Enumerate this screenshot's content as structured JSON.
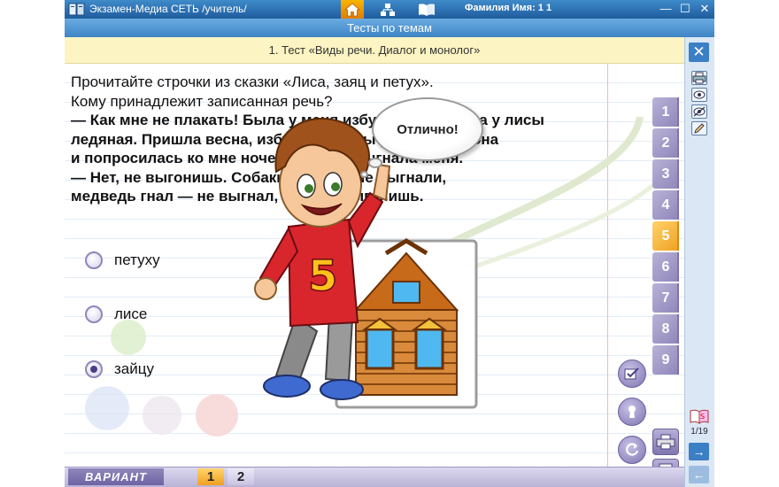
{
  "titlebar": {
    "title": "Экзамен-Медиа СЕТЬ /учитель/",
    "user": "Фамилия Имя:  1 1",
    "nav_icons": [
      "home-icon",
      "hierarchy-icon",
      "book-icon"
    ],
    "window_controls": {
      "minimize": "—",
      "maximize": "☐",
      "close": "✕"
    }
  },
  "section": {
    "title": "Тесты по темам"
  },
  "test": {
    "title": "1. Тест «Виды речи. Диалог и монолог»"
  },
  "question": {
    "intro_1": "Прочитайте строчки из сказки «Лиса, заяц и петух».",
    "intro_2": "Кому принадлежит записанная речь?",
    "text_1": "— Как мне не плакать! Была у меня избушка лубяная, а у лисы",
    "text_2": "ледяная. Пришла весна, избушка у лисы растаяла — она",
    "text_3": "и попросилась ко мне ночевать, да и выгнала меня.",
    "text_4": "— Нет, не выгонишь. Собаки гнали — не выгнали,",
    "text_5": "медведь гнал — не выгнал, и ты не выгонишь."
  },
  "options": [
    {
      "label": "петуху",
      "selected": false
    },
    {
      "label": "лисе",
      "selected": false
    },
    {
      "label": "зайцу",
      "selected": true
    }
  ],
  "question_tabs": [
    "1",
    "2",
    "3",
    "4",
    "5",
    "6",
    "7",
    "8",
    "9"
  ],
  "current_question_tab": "5",
  "feedback": {
    "text": "Отлично!"
  },
  "mascot": {
    "shirt_number": "5"
  },
  "side_tools": [
    "print-icon",
    "eye-icon",
    "eye-crossed-icon",
    "pencil-icon"
  ],
  "pagination": {
    "counter": "1/19"
  },
  "variant": {
    "label": "ВАРИАНТ",
    "options": [
      "1",
      "2"
    ],
    "selected": "1"
  },
  "colors": {
    "titlebar": "#2a6fb0",
    "accent_orange": "#f0a020",
    "tab_purple": "#8f86ba",
    "test_banner": "#fcf4c2"
  }
}
